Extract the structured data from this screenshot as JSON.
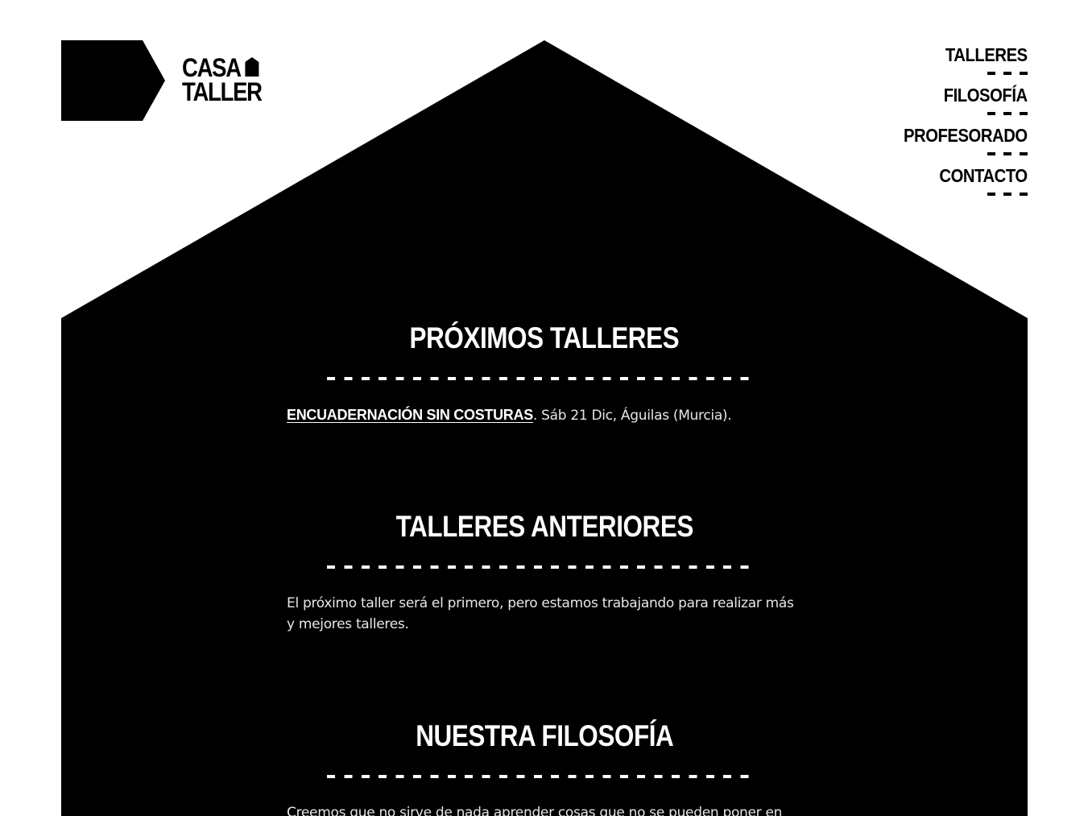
{
  "brand": {
    "line1": "CASA",
    "line2": "TALLER"
  },
  "nav": {
    "items": [
      {
        "label": "TALLERES"
      },
      {
        "label": "FILOSOFÍA"
      },
      {
        "label": "PROFESORADO"
      },
      {
        "label": "CONTACTO"
      }
    ]
  },
  "sections": {
    "upcoming": {
      "title": "PRÓXIMOS TALLERES",
      "workshop_link": "ENCUADERNACIÓN SIN COSTURAS",
      "workshop_details": ". Sáb 21 Dic, Águilas (Murcia)."
    },
    "previous": {
      "title": "TALLERES ANTERIORES",
      "text": "El próximo taller será el primero, pero estamos trabajando para realizar más y mejores talleres."
    },
    "philosophy": {
      "title": "NUESTRA FILOSOFÍA",
      "text": "Creemos que no sirve de nada aprender cosas que no se pueden poner en"
    }
  },
  "colors": {
    "background": "#ffffff",
    "house": "#000000",
    "text_on_dark": "#ffffff"
  }
}
